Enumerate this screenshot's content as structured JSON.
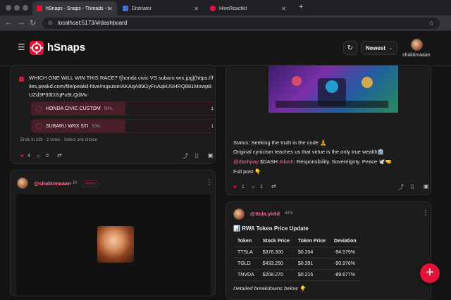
{
  "browser": {
    "tabs": [
      {
        "title": "hSnaps - Snaps - Threads - W",
        "active": true
      },
      {
        "title": "Distriator",
        "active": false
      },
      {
        "title": "HiveReactkit",
        "active": false
      }
    ],
    "new_tab": "+",
    "url": "localhost:5173/#/dashboard"
  },
  "app": {
    "name": "hSnaps",
    "sort_label": "Newest",
    "username": "shaktimaaan"
  },
  "colors": {
    "accent": "#e31337",
    "link": "#ff6b8a",
    "background": "#141414",
    "card": "#1c1c1c"
  },
  "poll_post": {
    "question": "WHICH ONE WILL WIN THIS RACE? ![honda civic VS subaru wrx.jpg](https://files.peakd.com/file/peakd-hive/nupuise/AKAqA89GyFnAqkUSHRQ881MowpBUZd3P93D2qPu9LQdMv",
    "options": [
      {
        "label": "HONDA CIVIC CUSTOM",
        "percent": "50%",
        "count": "1",
        "fill": 0.5
      },
      {
        "label": "SUBARU WRX STI",
        "percent": "50%",
        "count": "1",
        "fill": 0.5
      }
    ],
    "meta": {
      "ends": "Ends in 22h",
      "votes": "2 votes",
      "choice": "Select one choice"
    },
    "stats": {
      "votes": "4",
      "comments": "0"
    }
  },
  "shakti_post": {
    "author": "@shaktimaaan",
    "time": "1h",
    "badge": "Author"
  },
  "status_post": {
    "status_line": "Status: Seeking the truth in the code 🧘",
    "line2": "Original cynicism teaches us that virtue is the only true wealth🏛️",
    "mentions": {
      "m1": "@dashpay",
      "m2": "$DASH",
      "m3": "#dash"
    },
    "line3_rest": ": Responsibility. Sovereignty. Peace 🕊️🤜",
    "full_post": "Full post 👇",
    "stats": {
      "votes": "1",
      "comments": "1"
    }
  },
  "token_post": {
    "author": "@ttsla.yield",
    "time": "42m",
    "title": "📊 RWA Token Price Update",
    "headers": [
      "Token",
      "Stock Price",
      "Token Price",
      "Deviation"
    ],
    "rows": [
      [
        "TTSLA",
        "$376.300",
        "$0.204",
        "-94.579%"
      ],
      [
        "TGLD",
        "$433.250",
        "$0.391",
        "-90.976%"
      ],
      [
        "TNVDA",
        "$208.270",
        "$0.215",
        "-89.677%"
      ]
    ],
    "footer": "Detailed breakdowns below 👇"
  },
  "fab_label": "+"
}
